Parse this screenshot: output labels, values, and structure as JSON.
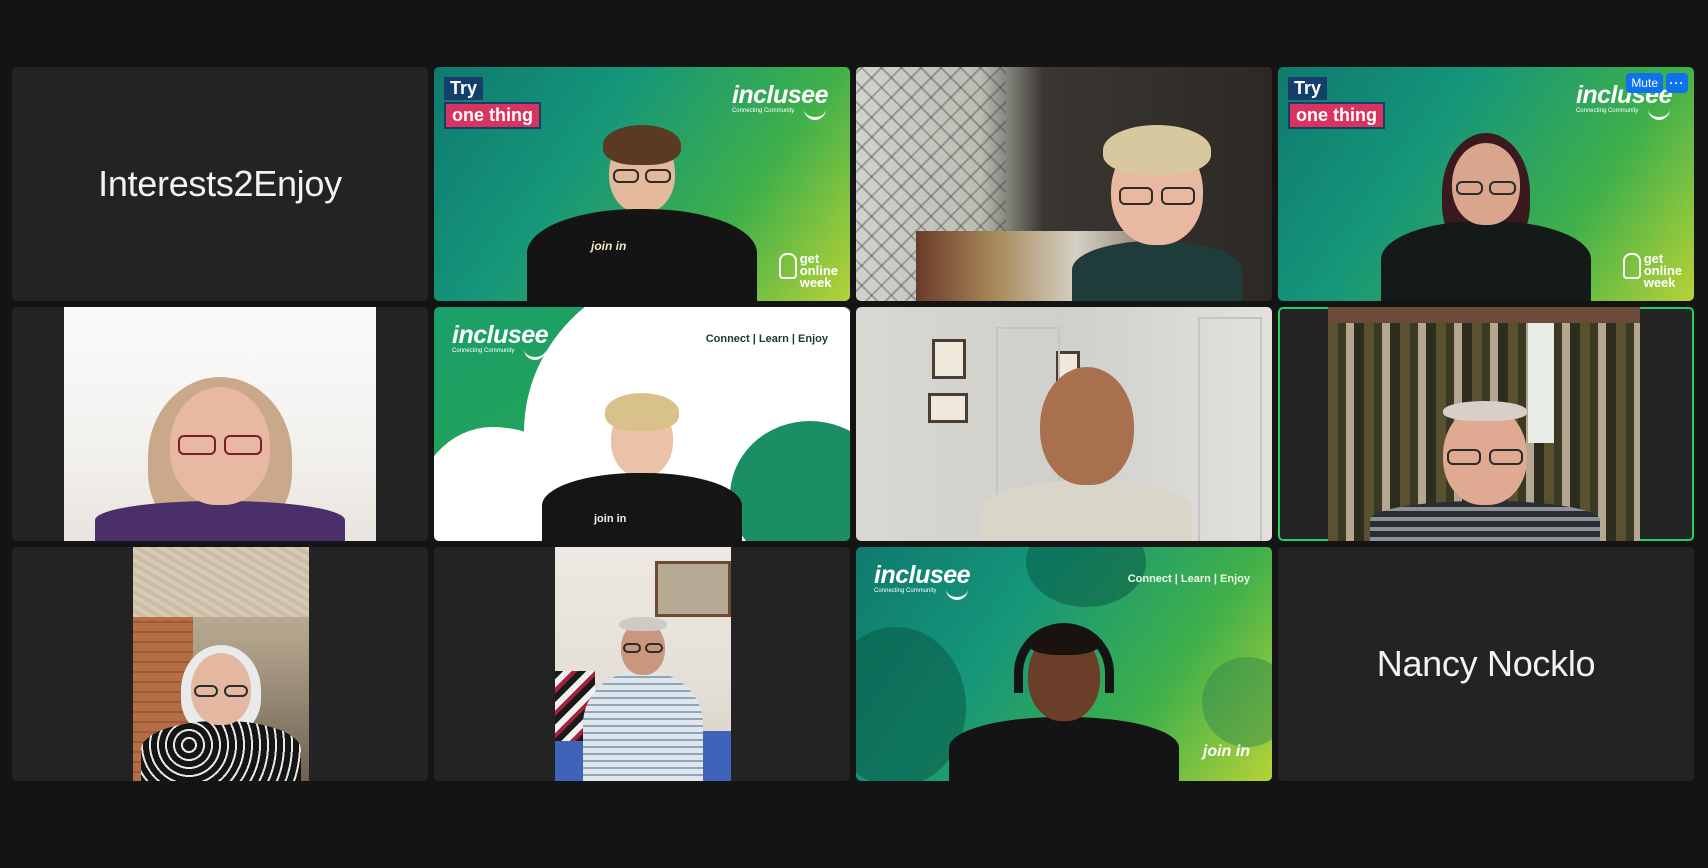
{
  "participants": [
    {
      "name": "Interests2Enjoy",
      "video": false
    },
    {
      "brand": "inclusee",
      "brand_sub": "Connecting Community",
      "badge_try": "Try",
      "badge_one": "one thing",
      "gow": [
        "get",
        "online",
        "week"
      ],
      "shirt_text": "join in"
    },
    {
      "video": true
    },
    {
      "brand": "inclusee",
      "brand_sub": "Connecting Community",
      "badge_try": "Try",
      "badge_one": "one thing",
      "gow": [
        "get",
        "online",
        "week"
      ]
    },
    {
      "video": true
    },
    {
      "brand": "inclusee",
      "brand_sub": "Connecting Community",
      "tagline": "Connect | Learn | Enjoy",
      "shirt_text": "join in"
    },
    {
      "video": true
    },
    {
      "video": true,
      "active": true
    },
    {
      "video": true
    },
    {
      "video": true
    },
    {
      "brand": "inclusee",
      "brand_sub": "Connecting Community",
      "tagline": "Connect | Learn | Enjoy",
      "joinin": "join in"
    },
    {
      "name": "Nancy Nocklo",
      "video": false
    }
  ],
  "controls": {
    "mute_label": "Mute",
    "more_label": "···"
  },
  "colors": {
    "accent": "#0e72ed",
    "active_speaker": "#23d160",
    "background": "#141414",
    "tile": "#232323"
  }
}
